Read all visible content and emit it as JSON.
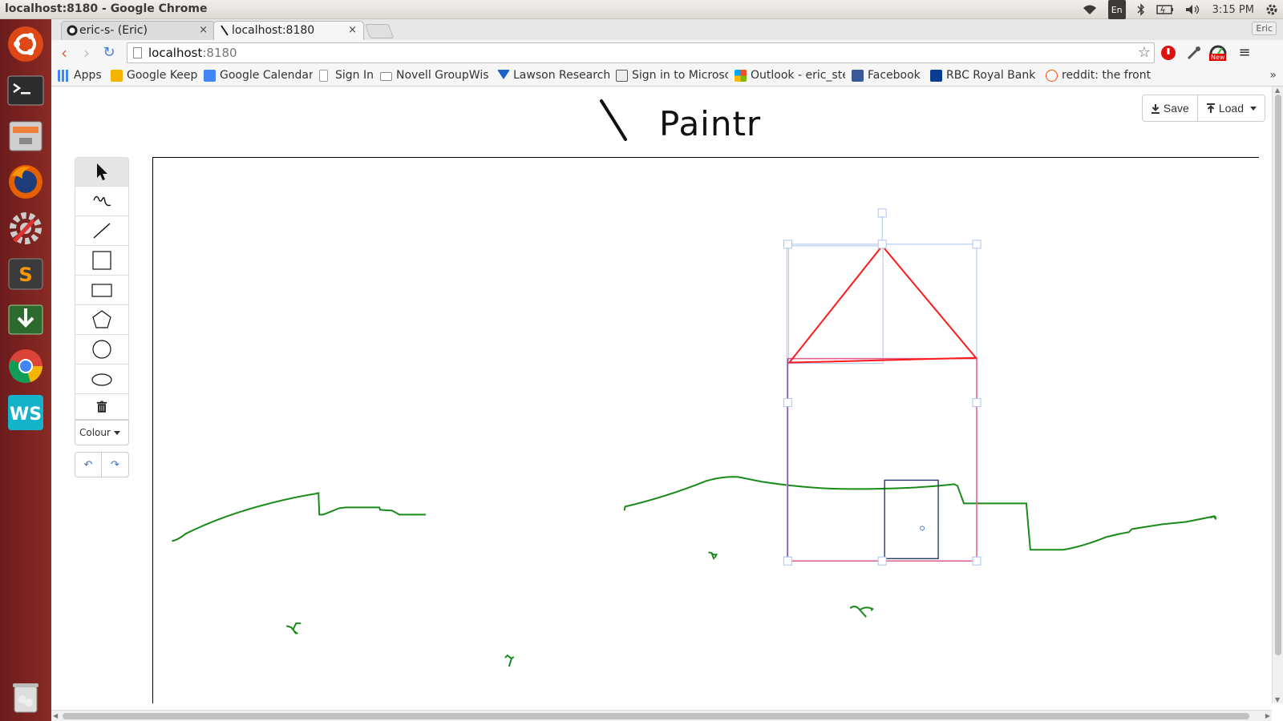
{
  "window": {
    "title": "localhost:8180 - Google Chrome"
  },
  "system_panel": {
    "keyboard_layout": "En",
    "clock": "3:15 PM"
  },
  "launcher": {
    "items": [
      "ubuntu-dash-icon",
      "terminal-icon",
      "files-icon",
      "firefox-icon",
      "system-settings-icon",
      "sublime-text-icon",
      "software-updater-icon",
      "chrome-icon",
      "webstorm-icon",
      "trash-icon"
    ]
  },
  "browser": {
    "tabs": [
      {
        "label": "eric-s- (Eric)"
      },
      {
        "label": "localhost:8180"
      }
    ],
    "close_glyph": "×",
    "profile": "Eric",
    "url": {
      "host": "localhost",
      "port": ":8180"
    },
    "extension_badge": "New",
    "bookmarks": [
      {
        "label": "Apps",
        "color": "#4285f4"
      },
      {
        "label": "Google Keep",
        "color": "#f4b400"
      },
      {
        "label": "Google Calendar",
        "color": "#4285f4"
      },
      {
        "label": "Sign In",
        "color": "#9e9e9e"
      },
      {
        "label": "Novell GroupWis",
        "color": "#9e9e9e"
      },
      {
        "label": "Lawson Research",
        "color": "#1e64c8"
      },
      {
        "label": "Sign in to Microsc",
        "color": "#555555"
      },
      {
        "label": "Outlook - eric_ste",
        "color": "#f25022"
      },
      {
        "label": "Facebook",
        "color": "#3b5998"
      },
      {
        "label": "RBC Royal Bank -",
        "color": "#0a3d91"
      },
      {
        "label": "reddit: the front p",
        "color": "#ff4500"
      }
    ],
    "more_bookmarks": "»"
  },
  "app": {
    "title": "Paintr",
    "save_label": "Save",
    "load_label": "Load",
    "colour_label": "Colour",
    "tools": [
      "select-tool",
      "freehand-tool",
      "line-tool",
      "square-tool",
      "rectangle-tool",
      "polygon-tool",
      "circle-tool",
      "ellipse-tool",
      "delete-tool"
    ],
    "active_tool": "select-tool",
    "undo_glyph": "↶",
    "redo_glyph": "↷"
  },
  "colors": {
    "launcher": "#7a2320",
    "stroke_green": "#1a8a1a",
    "stroke_red": "#ff1a1a",
    "selection_blue": "#a8c4f0",
    "door_navy": "#2b3a67"
  }
}
